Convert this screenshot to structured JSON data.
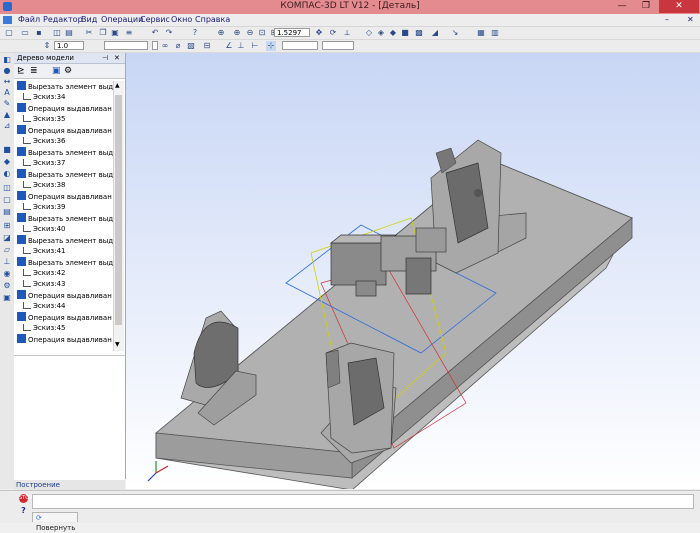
{
  "window": {
    "title": "КОМПАС-3D LT V12 - [Деталь]",
    "minimize_glyph": "—",
    "restore_glyph": "❐",
    "close_glyph": "✕"
  },
  "menu": [
    "Файл",
    "Редактор",
    "Вид",
    "Операции",
    "Сервис",
    "Окно",
    "Справка"
  ],
  "toolbar": {
    "line_width_value": "1.0",
    "zoom_value": "1.5297"
  },
  "tree": {
    "title": "Дерево модели",
    "items": [
      {
        "type": "op",
        "label": "Вырезать элемент выд"
      },
      {
        "type": "sketch",
        "label": "Эскиз:34"
      },
      {
        "type": "op",
        "label": "Операция выдавливан"
      },
      {
        "type": "sketch",
        "label": "Эскиз:35"
      },
      {
        "type": "op",
        "label": "Операция выдавливан"
      },
      {
        "type": "sketch",
        "label": "Эскиз:36"
      },
      {
        "type": "op",
        "label": "Вырезать элемент выд"
      },
      {
        "type": "sketch",
        "label": "Эскиз:37"
      },
      {
        "type": "op",
        "label": "Вырезать элемент выд"
      },
      {
        "type": "sketch",
        "label": "Эскиз:38"
      },
      {
        "type": "op",
        "label": "Операция выдавливан"
      },
      {
        "type": "sketch",
        "label": "Эскиз:39"
      },
      {
        "type": "op",
        "label": "Вырезать элемент выд"
      },
      {
        "type": "sketch",
        "label": "Эскиз:40"
      },
      {
        "type": "op",
        "label": "Вырезать элемент выд"
      },
      {
        "type": "sketch",
        "label": "Эскиз:41"
      },
      {
        "type": "op",
        "label": "Вырезать элемент выд"
      },
      {
        "type": "sketch",
        "label": "Эскиз:42"
      },
      {
        "type": "sketch",
        "label": "Эскиз:43"
      },
      {
        "type": "op",
        "label": "Операция выдавливан"
      },
      {
        "type": "sketch",
        "label": "Эскиз:44"
      },
      {
        "type": "op",
        "label": "Операция выдавливан"
      },
      {
        "type": "sketch",
        "label": "Эскиз:45"
      },
      {
        "type": "op",
        "label": "Операция выдавливан"
      }
    ]
  },
  "bottom_tab": "Построение",
  "status": {
    "stop_label": "STOP",
    "help_label": "?",
    "rotate_button": "Повернуть"
  },
  "colors": {
    "titlebar": "#e38b8f",
    "viewport_top": "#c8d6f5",
    "viewport_bottom": "#ffffff",
    "model_gray": "#a8a8a8",
    "accent_blue": "#1e58b8"
  }
}
